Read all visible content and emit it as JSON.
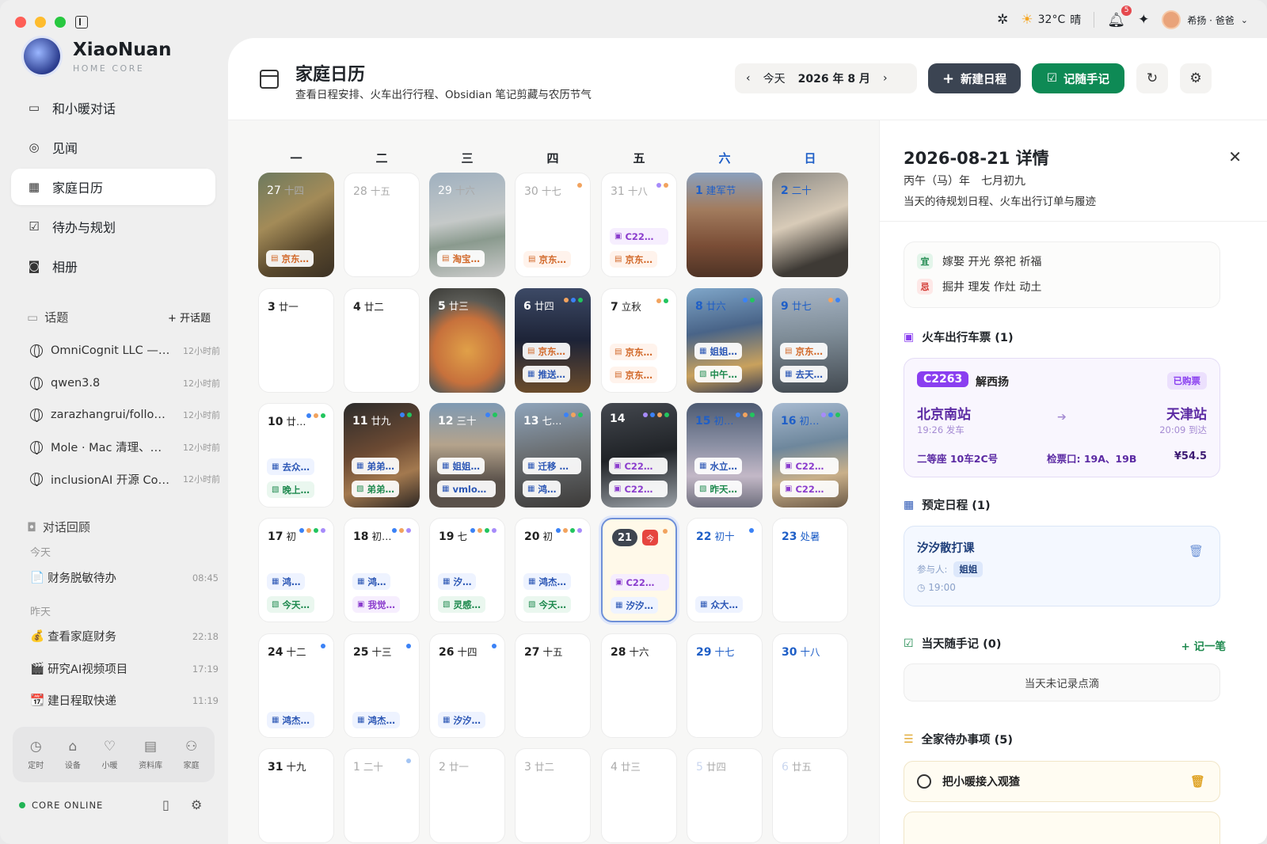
{
  "app": {
    "brand": "XiaoNuan",
    "brand_sub": "HOME CORE"
  },
  "topbar": {
    "weather_temp": "32°C",
    "weather_text": "晴",
    "notif_count": "5",
    "user_name": "希扬 · 爸爸"
  },
  "nav": [
    {
      "label": "和小暖对话",
      "icon": "chat-icon"
    },
    {
      "label": "见闻",
      "icon": "compass-icon"
    },
    {
      "label": "家庭日历",
      "icon": "calendar-icon",
      "active": true
    },
    {
      "label": "待办与规划",
      "icon": "checkbox-icon"
    },
    {
      "label": "相册",
      "icon": "camera-icon"
    }
  ],
  "topics": {
    "title": "话题",
    "add_label": "+ 开话题",
    "items": [
      {
        "text": "OmniCognit LLC —…",
        "time": "12小时前"
      },
      {
        "text": "qwen3.8",
        "time": "12小时前"
      },
      {
        "text": "zarazhangrui/follo…",
        "time": "12小时前"
      },
      {
        "text": "Mole · Mac 清理、…",
        "time": "12小时前"
      },
      {
        "text": "inclusionAI 开源 Co…",
        "time": "12小时前"
      }
    ]
  },
  "review": {
    "title": "对话回顾",
    "today_label": "今天",
    "yesterday_label": "昨天",
    "today": [
      {
        "text": "财务脱敏待办",
        "time": "08:45",
        "emoji": "📄"
      }
    ],
    "yesterday": [
      {
        "text": "查看家庭财务",
        "time": "22:18",
        "emoji": "💰"
      },
      {
        "text": "研究AI视频项目",
        "time": "17:19",
        "emoji": "🎬"
      },
      {
        "text": "建日程取快递",
        "time": "11:19",
        "emoji": "📆"
      }
    ]
  },
  "tools": [
    {
      "label": "定时"
    },
    {
      "label": "设备"
    },
    {
      "label": "小暖"
    },
    {
      "label": "资料库"
    },
    {
      "label": "家庭"
    }
  ],
  "status": "CORE ONLINE",
  "header": {
    "title": "家庭日历",
    "subtitle": "查看日程安排、火车出行行程、Obsidian 笔记剪藏与农历节气",
    "today_btn": "今天",
    "month": "2026 年 8 月",
    "new_btn": "新建日程",
    "note_btn": "记随手记"
  },
  "weekdays": [
    "一",
    "二",
    "三",
    "四",
    "五",
    "六",
    "日"
  ],
  "cells": [
    {
      "n": "27",
      "l": "十四",
      "dim": true,
      "photo": "ph1",
      "chips": [
        {
          "t": "京东…",
          "c": "o"
        }
      ]
    },
    {
      "n": "28",
      "l": "十五",
      "dim": true
    },
    {
      "n": "29",
      "l": "十六",
      "dim": true,
      "photo": "ph2",
      "chips": [
        {
          "t": "淘宝…",
          "c": "o"
        }
      ]
    },
    {
      "n": "30",
      "l": "十七",
      "dim": true,
      "dots": [
        "#f2a35e"
      ],
      "chips": [
        {
          "t": "京东…",
          "c": "o"
        }
      ]
    },
    {
      "n": "31",
      "l": "十八",
      "dim": true,
      "dots": [
        "#a78bfa",
        "#f2a35e"
      ],
      "chips": [
        {
          "t": "C22…",
          "c": "p"
        },
        {
          "t": "京东…",
          "c": "o"
        }
      ]
    },
    {
      "n": "1",
      "l": "建军节",
      "photo": "ph3",
      "wk": true
    },
    {
      "n": "2",
      "l": "二十",
      "photo": "ph4",
      "wk": true
    },
    {
      "n": "3",
      "l": "廿一"
    },
    {
      "n": "4",
      "l": "廿二"
    },
    {
      "n": "5",
      "l": "廿三",
      "photo": "ph5"
    },
    {
      "n": "6",
      "l": "廿四",
      "photo": "ph6",
      "dots": [
        "#f2a35e",
        "#3b82f6",
        "#22c55e"
      ],
      "chips": [
        {
          "t": "京东…",
          "c": "o"
        },
        {
          "t": "推送…",
          "c": "b"
        }
      ]
    },
    {
      "n": "7",
      "l": "立秋",
      "dots": [
        "#f2a35e",
        "#22c55e"
      ],
      "chips": [
        {
          "t": "京东…",
          "c": "o"
        },
        {
          "t": "京东…",
          "c": "o"
        }
      ]
    },
    {
      "n": "8",
      "l": "廿六",
      "photo": "ph7",
      "wk": true,
      "dots": [
        "#3b82f6",
        "#22c55e"
      ],
      "chips": [
        {
          "t": "姐姐…",
          "c": "b"
        },
        {
          "t": "中午…",
          "c": "g"
        }
      ]
    },
    {
      "n": "9",
      "l": "廿七",
      "photo": "ph8",
      "wk": true,
      "dots": [
        "#f2a35e",
        "#3b82f6"
      ],
      "chips": [
        {
          "t": "京东…",
          "c": "o"
        },
        {
          "t": "去天…",
          "c": "b"
        }
      ]
    },
    {
      "n": "10",
      "l": "廿…",
      "dots": [
        "#3b82f6",
        "#f2a35e",
        "#22c55e"
      ],
      "chips": [
        {
          "t": "去众…",
          "c": "b"
        },
        {
          "t": "晚上…",
          "c": "g"
        }
      ]
    },
    {
      "n": "11",
      "l": "廿九",
      "photo": "ph9",
      "dots": [
        "#3b82f6",
        "#22c55e"
      ],
      "chips": [
        {
          "t": "弟弟…",
          "c": "b"
        },
        {
          "t": "弟弟…",
          "c": "g"
        }
      ]
    },
    {
      "n": "12",
      "l": "三十",
      "photo": "ph10",
      "dots": [
        "#3b82f6",
        "#22c55e"
      ],
      "chips": [
        {
          "t": "姐姐…",
          "c": "b"
        },
        {
          "t": "vmlo…",
          "c": "b"
        }
      ]
    },
    {
      "n": "13",
      "l": "七…",
      "photo": "ph11",
      "dots": [
        "#3b82f6",
        "#f2a35e",
        "#22c55e"
      ],
      "chips": [
        {
          "t": "迁移 …",
          "c": "b"
        },
        {
          "t": "鸿…",
          "c": "b"
        }
      ]
    },
    {
      "n": "14",
      "l": "",
      "photo": "ph12",
      "dots": [
        "#a78bfa",
        "#3b82f6",
        "#f2a35e",
        "#22c55e"
      ],
      "chips": [
        {
          "t": "C22…",
          "c": "p"
        },
        {
          "t": "C22…",
          "c": "p"
        }
      ]
    },
    {
      "n": "15",
      "l": "初…",
      "photo": "ph13",
      "wk": true,
      "dots": [
        "#3b82f6",
        "#f2a35e",
        "#22c55e"
      ],
      "chips": [
        {
          "t": "水立…",
          "c": "b"
        },
        {
          "t": "昨天…",
          "c": "g"
        }
      ]
    },
    {
      "n": "16",
      "l": "初…",
      "photo": "ph14",
      "wk": true,
      "dots": [
        "#a78bfa",
        "#3b82f6",
        "#22c55e"
      ],
      "chips": [
        {
          "t": "C22…",
          "c": "p"
        },
        {
          "t": "C22…",
          "c": "p"
        }
      ]
    },
    {
      "n": "17",
      "l": "初",
      "dots": [
        "#3b82f6",
        "#f2a35e",
        "#22c55e",
        "#a78bfa"
      ],
      "chips": [
        {
          "t": "鸿…",
          "c": "b"
        },
        {
          "t": "今天…",
          "c": "g"
        }
      ]
    },
    {
      "n": "18",
      "l": "初…",
      "dots": [
        "#3b82f6",
        "#f2a35e",
        "#a78bfa"
      ],
      "chips": [
        {
          "t": "鸿…",
          "c": "b"
        },
        {
          "t": "我觉…",
          "c": "p"
        }
      ]
    },
    {
      "n": "19",
      "l": "七",
      "dots": [
        "#3b82f6",
        "#f2a35e",
        "#22c55e",
        "#a78bfa"
      ],
      "chips": [
        {
          "t": "汐…",
          "c": "b"
        },
        {
          "t": "灵感…",
          "c": "g"
        }
      ]
    },
    {
      "n": "20",
      "l": "初",
      "dots": [
        "#3b82f6",
        "#f2a35e",
        "#22c55e",
        "#a78bfa"
      ],
      "chips": [
        {
          "t": "鸿杰…",
          "c": "b"
        },
        {
          "t": "今天…",
          "c": "g"
        }
      ]
    },
    {
      "n": "21",
      "today": true,
      "today_tag": "今",
      "dots": [
        "#f2a35e"
      ],
      "chips": [
        {
          "t": "C22…",
          "c": "p"
        },
        {
          "t": "汐汐…",
          "c": "b"
        }
      ]
    },
    {
      "n": "22",
      "l": "初十",
      "wk": true,
      "dots": [
        "#3b82f6"
      ],
      "chips": [
        {
          "t": "众大…",
          "c": "b"
        }
      ]
    },
    {
      "n": "23",
      "l": "处暑",
      "wk": true
    },
    {
      "n": "24",
      "l": "十二",
      "dots": [
        "#3b82f6"
      ],
      "chips": [
        {
          "t": "鸿杰…",
          "c": "b"
        }
      ]
    },
    {
      "n": "25",
      "l": "十三",
      "dots": [
        "#3b82f6"
      ],
      "chips": [
        {
          "t": "鸿杰…",
          "c": "b"
        }
      ]
    },
    {
      "n": "26",
      "l": "十四",
      "dots": [
        "#3b82f6"
      ],
      "chips": [
        {
          "t": "汐汐…",
          "c": "b"
        }
      ]
    },
    {
      "n": "27",
      "l": "十五"
    },
    {
      "n": "28",
      "l": "十六"
    },
    {
      "n": "29",
      "l": "十七",
      "wk": true
    },
    {
      "n": "30",
      "l": "十八",
      "wk": true
    },
    {
      "n": "31",
      "l": "十九"
    },
    {
      "n": "1",
      "l": "二十",
      "dim": true,
      "dots": [
        "#a3c4f3"
      ]
    },
    {
      "n": "2",
      "l": "廿一",
      "dim": true
    },
    {
      "n": "3",
      "l": "廿二",
      "dim": true
    },
    {
      "n": "4",
      "l": "廿三",
      "dim": true
    },
    {
      "n": "5",
      "l": "廿四",
      "dim": true,
      "fadewk": true
    },
    {
      "n": "6",
      "l": "廿五",
      "dim": true,
      "fadewk": true
    }
  ],
  "detail": {
    "title": "2026-08-21 详情",
    "lunar": "丙午（马）年　七月初九",
    "desc": "当天的待规划日程、火车出行订单与履迹",
    "yi_tag": "宜",
    "yi": "嫁娶 开光 祭祀 祈福",
    "ji_tag": "忌",
    "ji": "掘井 理发 作灶 动土",
    "train_title": "火车出行车票 (1)",
    "train": {
      "no": "C2263",
      "passenger": "解西扬",
      "status": "已购票",
      "from": "北京南站",
      "to": "天津站",
      "dep": "19:26 发车",
      "arr": "20:09 到达",
      "seat": "二等座 10车2C号",
      "gate": "检票口: 19A、19B",
      "price": "¥54.5"
    },
    "sched_title": "预定日程 (1)",
    "event": {
      "title": "汐汐散打课",
      "participants_label": "参与人:",
      "participant": "姐姐",
      "time": "19:00"
    },
    "note_title": "当天随手记 (0)",
    "note_add": "+ 记一笔",
    "note_empty": "当天未记录点滴",
    "todo_title": "全家待办事项 (5)",
    "todo": "把小暖接入观猹"
  }
}
